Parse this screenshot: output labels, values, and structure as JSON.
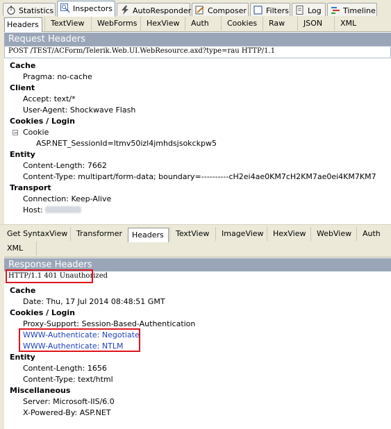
{
  "main_tabs": [
    {
      "label": "Statistics",
      "icon": "stopwatch-icon"
    },
    {
      "label": "Inspectors",
      "icon": "magnifier-icon",
      "active": true
    },
    {
      "label": "AutoResponder",
      "icon": "lightning-icon"
    },
    {
      "label": "Composer",
      "icon": "pencil-icon"
    },
    {
      "label": "Filters",
      "icon": "checkbox-icon"
    },
    {
      "label": "Log",
      "icon": "document-icon"
    },
    {
      "label": "Timeline",
      "icon": "timeline-icon"
    }
  ],
  "request": {
    "tabs": [
      "Headers",
      "TextView",
      "WebForms",
      "HexView",
      "Auth",
      "Cookies",
      "Raw",
      "JSON",
      "XML"
    ],
    "active_tab": "Headers",
    "section_title": "Request Headers",
    "request_line": "POST /TEST/ACForm/Telerik.Web.UI.WebResource.axd?type=rau HTTP/1.1",
    "groups": {
      "cache": {
        "title": "Cache",
        "items": [
          "Pragma: no-cache"
        ]
      },
      "client": {
        "title": "Client",
        "items": [
          "Accept: text/*",
          "User-Agent: Shockwave Flash"
        ]
      },
      "cookies": {
        "title": "Cookies / Login",
        "cookie_label": "Cookie",
        "cookie_value": "ASP.NET_SessionId=ltmv50izl4jmhdsjsokckpw5"
      },
      "entity": {
        "title": "Entity",
        "items": [
          "Content-Length: 7662",
          "Content-Type: multipart/form-data; boundary=----------cH2ei4ae0KM7cH2KM7ae0ei4KM7KM7"
        ]
      },
      "transport": {
        "title": "Transport",
        "items": [
          "Connection: Keep-Alive",
          "Host:"
        ]
      }
    }
  },
  "response": {
    "tabs_row1": [
      "Get SyntaxView",
      "Transformer",
      "Headers",
      "TextView",
      "ImageView",
      "HexView",
      "WebView",
      "Auth"
    ],
    "tabs_row2": [
      "XML"
    ],
    "active_tab": "Headers",
    "section_title": "Response Headers",
    "status_line": "HTTP/1.1 401 Unauthorized",
    "groups": {
      "cache": {
        "title": "Cache",
        "items": [
          "Date: Thu, 17 Jul 2014 08:48:51 GMT"
        ]
      },
      "cookies": {
        "title": "Cookies / Login",
        "items": [
          "Proxy-Support: Session-Based-Authentication"
        ],
        "auth_items": [
          "WWW-Authenticate: Negotiate",
          "WWW-Authenticate: NTLM"
        ]
      },
      "entity": {
        "title": "Entity",
        "items": [
          "Content-Length: 1656",
          "Content-Type: text/html"
        ]
      },
      "misc": {
        "title": "Miscellaneous",
        "items": [
          "Server: Microsoft-IIS/6.0",
          "X-Powered-By: ASP.NET"
        ]
      }
    }
  },
  "colors": {
    "highlight_box": "#e0141c",
    "link": "#1f3fbf",
    "section_header": "#9aa6b8"
  }
}
